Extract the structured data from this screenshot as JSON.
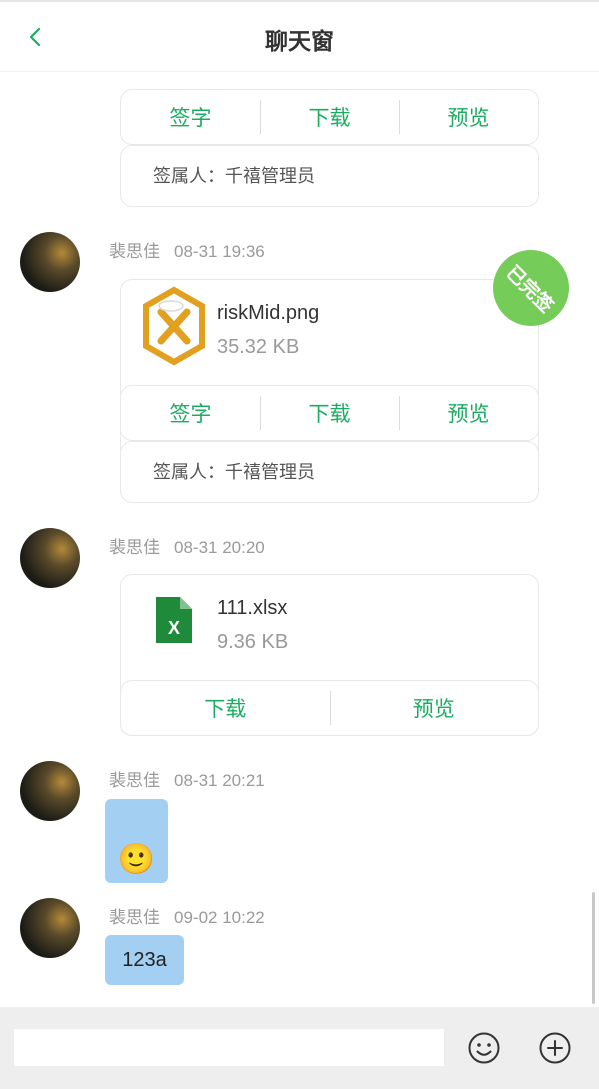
{
  "header": {
    "title": "聊天窗"
  },
  "labels": {
    "sign": "签字",
    "download": "下载",
    "preview": "预览",
    "signer_prefix": "签属人："
  },
  "messages": [
    {
      "signer": "千禧管理员"
    },
    {
      "sender": "裴思佳",
      "time": "08-31 19:36",
      "file_name": "riskMid.png",
      "file_size": "35.32 KB",
      "badge": "已完签",
      "signer": "千禧管理员"
    },
    {
      "sender": "裴思佳",
      "time": "08-31 20:20",
      "file_name": "111.xlsx",
      "file_size": "9.36 KB"
    },
    {
      "sender": "裴思佳",
      "time": "08-31 20:21",
      "emoji": "🙂"
    },
    {
      "sender": "裴思佳",
      "time": "09-02 10:22",
      "text": "123a"
    }
  ],
  "footer": {
    "input_placeholder": ""
  },
  "colors": {
    "accent": "#1aad61",
    "badge": "#76cc58",
    "bubble": "#a3d0f2",
    "footer_bg": "#eeeeee"
  }
}
